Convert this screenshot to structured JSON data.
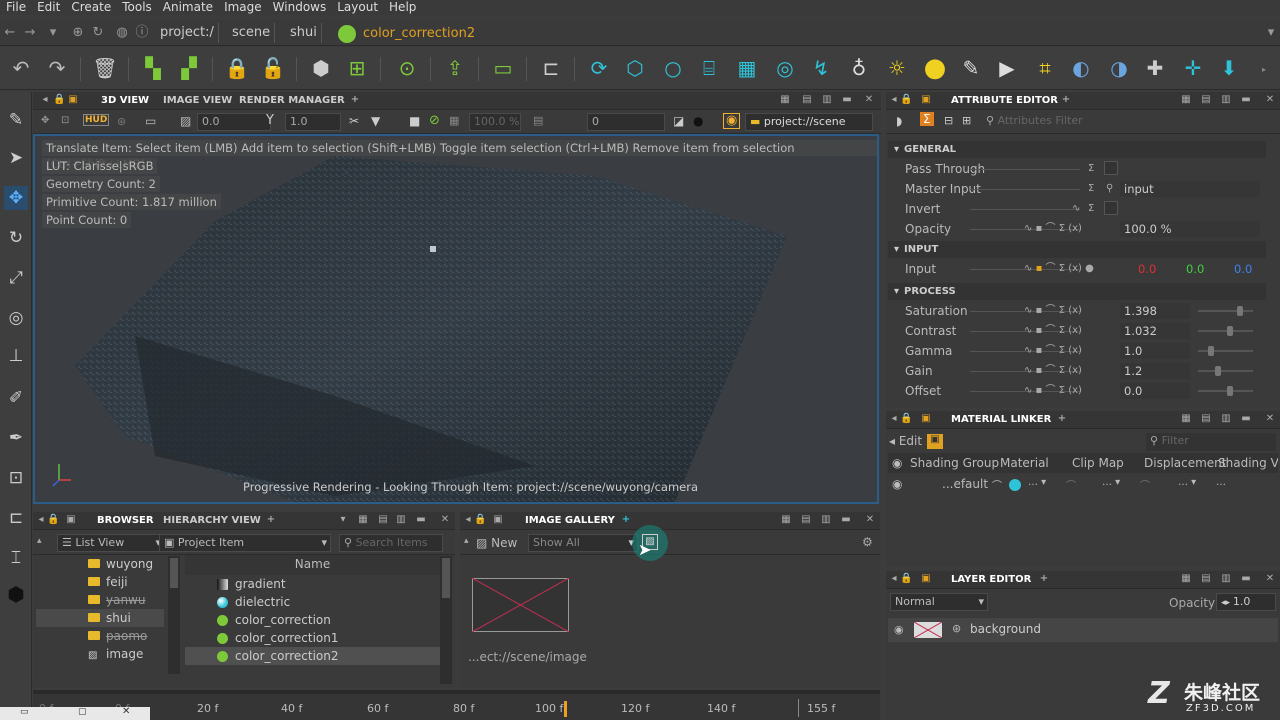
{
  "menubar": [
    "File",
    "Edit",
    "Create",
    "Tools",
    "Animate",
    "Image",
    "Windows",
    "Layout",
    "Help"
  ],
  "path": {
    "crumbs": [
      "project:/",
      "scene",
      "shui"
    ],
    "current": "color_correction2"
  },
  "viewport_panel": {
    "tabs": [
      "3D VIEW",
      "IMAGE VIEW",
      "RENDER MANAGER"
    ],
    "hud_label": "HUD",
    "field_val1": "0.0",
    "field_val2": "1.0",
    "zoom": "100.0 %",
    "frame": "0",
    "context": "project://scene"
  },
  "hud": {
    "instructions": "Translate Item: Select item (LMB)  Add item to selection (Shift+LMB)  Toggle item selection (Ctrl+LMB)  Remove item from selection (Ctrl+Shift+LMB)",
    "lut": "LUT: Clarisse|sRGB",
    "geometry": "Geometry Count: 2",
    "primitive": "Primitive Count: 1.817 million",
    "points": "Point Count: 0",
    "status": "Progressive Rendering - Looking Through Item: project://scene/wuyong/camera"
  },
  "attribute_editor": {
    "title": "ATTRIBUTE EDITOR",
    "filter_placeholder": "Attributes Filter",
    "general": "GENERAL",
    "pass_through": "Pass Through",
    "master_input": "Master Input",
    "master_input_val": "input",
    "invert": "Invert",
    "opacity": "Opacity",
    "opacity_val": "100.0 %",
    "input_sec": "INPUT",
    "input": "Input",
    "input_r": "0.0",
    "input_g": "0.0",
    "input_b": "0.0",
    "process_sec": "PROCESS",
    "rows": [
      {
        "label": "Saturation",
        "value": "1.398",
        "level": 0.8
      },
      {
        "label": "Contrast",
        "value": "1.032",
        "level": 0.6
      },
      {
        "label": "Gamma",
        "value": "1.0",
        "level": 0.2
      },
      {
        "label": "Gain",
        "value": "1.2",
        "level": 0.35
      },
      {
        "label": "Offset",
        "value": "0.0",
        "level": 0.6
      }
    ]
  },
  "material_linker": {
    "title": "MATERIAL LINKER",
    "edit": "Edit",
    "filter_placeholder": "Filter",
    "cols": [
      "Shading Group",
      "Material",
      "Clip Map",
      "Displacement",
      "Shading Variable"
    ],
    "row_default": "...efault"
  },
  "layer_editor": {
    "title": "LAYER EDITOR",
    "blend": "Normal",
    "opacity_label": "Opacity",
    "opacity_val": "1.0",
    "layer": "background"
  },
  "browser": {
    "tabs": [
      "BROWSER",
      "HIERARCHY VIEW"
    ],
    "view_mode": "List View",
    "scope": "Project Item",
    "search_placeholder": "Search Items",
    "folders": [
      "wuyong",
      "feiji",
      "yanwu",
      "shui",
      "paomo",
      "image"
    ],
    "name_col": "Name",
    "items": [
      "gradient",
      "dielectric",
      "color_correction",
      "color_correction1",
      "color_correction2"
    ]
  },
  "gallery": {
    "title": "IMAGE GALLERY",
    "new": "New",
    "show": "Show All",
    "path": "...ect://scene/image"
  },
  "timeline": {
    "ticks": [
      "0 f",
      "0 f",
      "20 f",
      "40 f",
      "60 f",
      "80 f",
      "100 f",
      "120 f",
      "140 f",
      "155 f"
    ]
  },
  "watermark": {
    "text": "朱峰社区",
    "url": "ZF3D.COM"
  }
}
